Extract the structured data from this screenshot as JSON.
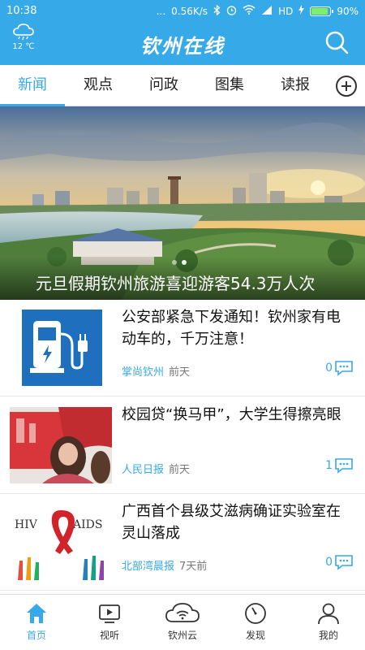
{
  "status_bar": {
    "time": "10:38",
    "dots": "...",
    "speed": "0.56K/s",
    "network": "HD",
    "battery": "90%"
  },
  "header": {
    "title": "钦州在线",
    "temperature": "12 ℃",
    "weather_icon": "cloud-rain-icon",
    "search_icon": "search-icon"
  },
  "tabs": [
    {
      "label": "新闻",
      "active": true
    },
    {
      "label": "观点"
    },
    {
      "label": "问政"
    },
    {
      "label": "图集"
    },
    {
      "label": "读报"
    }
  ],
  "banner": {
    "caption": "元旦假期钦州旅游喜迎游客54.3万人次",
    "slide_count": 2,
    "active_slide": 2
  },
  "news": [
    {
      "title": "公安部紧急下发通知！钦州家有电动车的，千万注意！",
      "source": "掌尚钦州",
      "time": "前天",
      "comments": "0"
    },
    {
      "title": "校园贷“换马甲”，大学生得擦亮眼",
      "source": "人民日报",
      "time": "前天",
      "comments": "1"
    },
    {
      "title": "广西首个县级艾滋病确证实验室在灵山落成",
      "source": "北部湾晨报",
      "time": "7天前",
      "comments": "0"
    }
  ],
  "thumb3": {
    "left_text": "HIV",
    "right_text": "AIDS"
  },
  "bottom_nav": [
    {
      "label": "首页",
      "icon": "home-icon",
      "active": true
    },
    {
      "label": "视听",
      "icon": "video-icon"
    },
    {
      "label": "钦州云",
      "icon": "cloud-icon"
    },
    {
      "label": "发现",
      "icon": "compass-icon"
    },
    {
      "label": "我的",
      "icon": "user-icon"
    }
  ],
  "colors": {
    "accent": "#36a9e8",
    "text": "#222222"
  }
}
